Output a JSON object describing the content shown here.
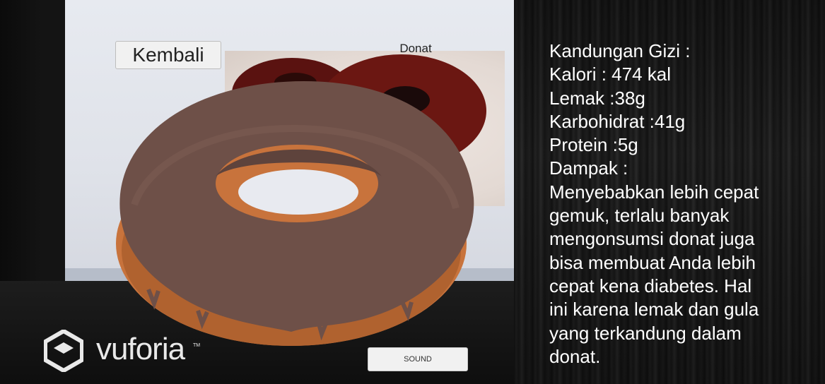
{
  "scene": {
    "object_label": "Donat"
  },
  "buttons": {
    "back_label": "Kembali",
    "sound_label": "SOUND"
  },
  "watermark": {
    "brand": "vuforia",
    "trademark": "TM"
  },
  "info": {
    "lines": [
      "Kandungan Gizi :",
      "Kalori : 474 kal",
      "Lemak :38g",
      "Karbohidrat :41g",
      "Protein :5g",
      "Dampak :",
      "Menyebabkan lebih cepat",
      "gemuk, terlalu banyak",
      "mengonsumsi donat juga",
      "bisa membuat Anda lebih",
      "cepat kena diabetes. Hal",
      "ini karena lemak dan gula",
      "yang terkandung dalam",
      "donat."
    ]
  },
  "icons": {
    "brand_logo": "vuforia-logo-icon",
    "model": "donut-3d-model-icon"
  },
  "colors": {
    "icing": "#6e5048",
    "dough": "#c8733c",
    "panel_text": "#ffffff",
    "button_bg": "#f1f1f1"
  }
}
